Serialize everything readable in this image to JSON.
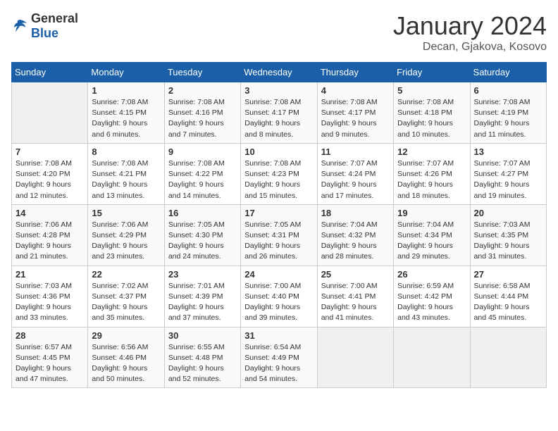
{
  "logo": {
    "general": "General",
    "blue": "Blue"
  },
  "header": {
    "month": "January 2024",
    "location": "Decan, Gjakova, Kosovo"
  },
  "weekdays": [
    "Sunday",
    "Monday",
    "Tuesday",
    "Wednesday",
    "Thursday",
    "Friday",
    "Saturday"
  ],
  "weeks": [
    [
      {
        "day": "",
        "sunrise": "",
        "sunset": "",
        "daylight": ""
      },
      {
        "day": "1",
        "sunrise": "Sunrise: 7:08 AM",
        "sunset": "Sunset: 4:15 PM",
        "daylight": "Daylight: 9 hours and 6 minutes."
      },
      {
        "day": "2",
        "sunrise": "Sunrise: 7:08 AM",
        "sunset": "Sunset: 4:16 PM",
        "daylight": "Daylight: 9 hours and 7 minutes."
      },
      {
        "day": "3",
        "sunrise": "Sunrise: 7:08 AM",
        "sunset": "Sunset: 4:17 PM",
        "daylight": "Daylight: 9 hours and 8 minutes."
      },
      {
        "day": "4",
        "sunrise": "Sunrise: 7:08 AM",
        "sunset": "Sunset: 4:17 PM",
        "daylight": "Daylight: 9 hours and 9 minutes."
      },
      {
        "day": "5",
        "sunrise": "Sunrise: 7:08 AM",
        "sunset": "Sunset: 4:18 PM",
        "daylight": "Daylight: 9 hours and 10 minutes."
      },
      {
        "day": "6",
        "sunrise": "Sunrise: 7:08 AM",
        "sunset": "Sunset: 4:19 PM",
        "daylight": "Daylight: 9 hours and 11 minutes."
      }
    ],
    [
      {
        "day": "7",
        "sunrise": "Sunrise: 7:08 AM",
        "sunset": "Sunset: 4:20 PM",
        "daylight": "Daylight: 9 hours and 12 minutes."
      },
      {
        "day": "8",
        "sunrise": "Sunrise: 7:08 AM",
        "sunset": "Sunset: 4:21 PM",
        "daylight": "Daylight: 9 hours and 13 minutes."
      },
      {
        "day": "9",
        "sunrise": "Sunrise: 7:08 AM",
        "sunset": "Sunset: 4:22 PM",
        "daylight": "Daylight: 9 hours and 14 minutes."
      },
      {
        "day": "10",
        "sunrise": "Sunrise: 7:08 AM",
        "sunset": "Sunset: 4:23 PM",
        "daylight": "Daylight: 9 hours and 15 minutes."
      },
      {
        "day": "11",
        "sunrise": "Sunrise: 7:07 AM",
        "sunset": "Sunset: 4:24 PM",
        "daylight": "Daylight: 9 hours and 17 minutes."
      },
      {
        "day": "12",
        "sunrise": "Sunrise: 7:07 AM",
        "sunset": "Sunset: 4:26 PM",
        "daylight": "Daylight: 9 hours and 18 minutes."
      },
      {
        "day": "13",
        "sunrise": "Sunrise: 7:07 AM",
        "sunset": "Sunset: 4:27 PM",
        "daylight": "Daylight: 9 hours and 19 minutes."
      }
    ],
    [
      {
        "day": "14",
        "sunrise": "Sunrise: 7:06 AM",
        "sunset": "Sunset: 4:28 PM",
        "daylight": "Daylight: 9 hours and 21 minutes."
      },
      {
        "day": "15",
        "sunrise": "Sunrise: 7:06 AM",
        "sunset": "Sunset: 4:29 PM",
        "daylight": "Daylight: 9 hours and 23 minutes."
      },
      {
        "day": "16",
        "sunrise": "Sunrise: 7:05 AM",
        "sunset": "Sunset: 4:30 PM",
        "daylight": "Daylight: 9 hours and 24 minutes."
      },
      {
        "day": "17",
        "sunrise": "Sunrise: 7:05 AM",
        "sunset": "Sunset: 4:31 PM",
        "daylight": "Daylight: 9 hours and 26 minutes."
      },
      {
        "day": "18",
        "sunrise": "Sunrise: 7:04 AM",
        "sunset": "Sunset: 4:32 PM",
        "daylight": "Daylight: 9 hours and 28 minutes."
      },
      {
        "day": "19",
        "sunrise": "Sunrise: 7:04 AM",
        "sunset": "Sunset: 4:34 PM",
        "daylight": "Daylight: 9 hours and 29 minutes."
      },
      {
        "day": "20",
        "sunrise": "Sunrise: 7:03 AM",
        "sunset": "Sunset: 4:35 PM",
        "daylight": "Daylight: 9 hours and 31 minutes."
      }
    ],
    [
      {
        "day": "21",
        "sunrise": "Sunrise: 7:03 AM",
        "sunset": "Sunset: 4:36 PM",
        "daylight": "Daylight: 9 hours and 33 minutes."
      },
      {
        "day": "22",
        "sunrise": "Sunrise: 7:02 AM",
        "sunset": "Sunset: 4:37 PM",
        "daylight": "Daylight: 9 hours and 35 minutes."
      },
      {
        "day": "23",
        "sunrise": "Sunrise: 7:01 AM",
        "sunset": "Sunset: 4:39 PM",
        "daylight": "Daylight: 9 hours and 37 minutes."
      },
      {
        "day": "24",
        "sunrise": "Sunrise: 7:00 AM",
        "sunset": "Sunset: 4:40 PM",
        "daylight": "Daylight: 9 hours and 39 minutes."
      },
      {
        "day": "25",
        "sunrise": "Sunrise: 7:00 AM",
        "sunset": "Sunset: 4:41 PM",
        "daylight": "Daylight: 9 hours and 41 minutes."
      },
      {
        "day": "26",
        "sunrise": "Sunrise: 6:59 AM",
        "sunset": "Sunset: 4:42 PM",
        "daylight": "Daylight: 9 hours and 43 minutes."
      },
      {
        "day": "27",
        "sunrise": "Sunrise: 6:58 AM",
        "sunset": "Sunset: 4:44 PM",
        "daylight": "Daylight: 9 hours and 45 minutes."
      }
    ],
    [
      {
        "day": "28",
        "sunrise": "Sunrise: 6:57 AM",
        "sunset": "Sunset: 4:45 PM",
        "daylight": "Daylight: 9 hours and 47 minutes."
      },
      {
        "day": "29",
        "sunrise": "Sunrise: 6:56 AM",
        "sunset": "Sunset: 4:46 PM",
        "daylight": "Daylight: 9 hours and 50 minutes."
      },
      {
        "day": "30",
        "sunrise": "Sunrise: 6:55 AM",
        "sunset": "Sunset: 4:48 PM",
        "daylight": "Daylight: 9 hours and 52 minutes."
      },
      {
        "day": "31",
        "sunrise": "Sunrise: 6:54 AM",
        "sunset": "Sunset: 4:49 PM",
        "daylight": "Daylight: 9 hours and 54 minutes."
      },
      {
        "day": "",
        "sunrise": "",
        "sunset": "",
        "daylight": ""
      },
      {
        "day": "",
        "sunrise": "",
        "sunset": "",
        "daylight": ""
      },
      {
        "day": "",
        "sunrise": "",
        "sunset": "",
        "daylight": ""
      }
    ]
  ]
}
